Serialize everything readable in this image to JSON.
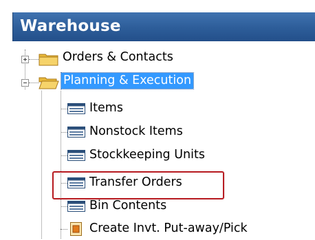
{
  "window": {
    "title": "Warehouse"
  },
  "tree": {
    "nodes": [
      {
        "label": "Orders & Contacts",
        "type": "folder",
        "state": "collapsed"
      },
      {
        "label": "Planning & Execution",
        "type": "folder",
        "state": "expanded",
        "selected": true
      },
      {
        "label": "Items",
        "type": "list-page"
      },
      {
        "label": "Nonstock Items",
        "type": "list-page"
      },
      {
        "label": "Stockkeeping Units",
        "type": "list-page"
      },
      {
        "label": "Transfer Orders",
        "type": "list-page",
        "highlighted": true
      },
      {
        "label": "Bin Contents",
        "type": "list-page"
      },
      {
        "label": "Create Invt. Put-away/Pick",
        "type": "report"
      }
    ]
  },
  "colors": {
    "title_bar": "#2d5d99",
    "selection": "#3399ff",
    "highlight_border": "#b81c22",
    "folder": "#f2c94c"
  }
}
